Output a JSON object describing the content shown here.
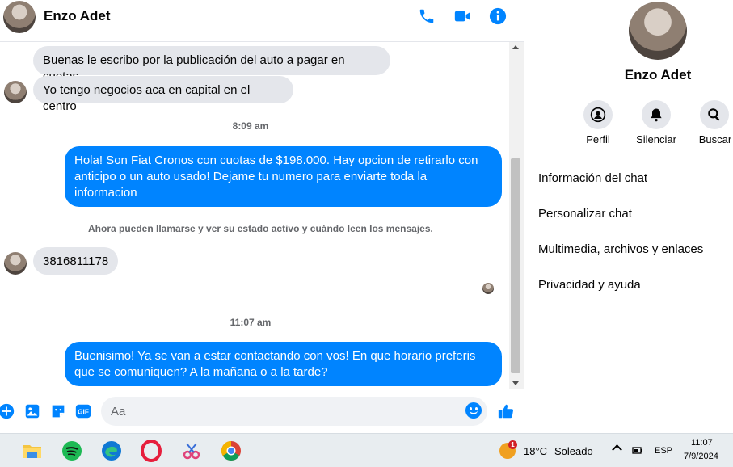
{
  "header": {
    "contact_name": "Enzo Adet",
    "actions": [
      "phone-icon",
      "video-icon",
      "info-icon"
    ],
    "accent": "#0084ff"
  },
  "messages": [
    {
      "side": "in",
      "text": "Buenas le escribo por la publicación del auto a pagar en cuotas"
    },
    {
      "side": "in",
      "text": "Yo tengo negocios aca en capital en el centro"
    },
    {
      "type": "time",
      "text": "8:09 am"
    },
    {
      "side": "out",
      "text": "Hola! Son Fiat Cronos con cuotas de $198.000. Hay opcion de retirarlo con anticipo o un auto usado! Dejame tu numero para enviarte toda la informacion"
    },
    {
      "type": "notice",
      "text": "Ahora pueden llamarse y ver su estado activo y cuándo leen los mensajes."
    },
    {
      "side": "in",
      "text": "3816811178"
    },
    {
      "type": "time",
      "text": "11:07 am"
    },
    {
      "side": "out",
      "text": "Buenisimo! Ya se van a estar contactando con vos! En que horario preferis que se comuniquen? A la mañana o a la tarde?"
    }
  ],
  "composer": {
    "placeholder": "Aa",
    "icons": [
      "plus-icon",
      "image-icon",
      "sticker-icon",
      "gif-icon",
      "emoji-icon",
      "like-icon"
    ]
  },
  "panel": {
    "name": "Enzo Adet",
    "buttons": [
      {
        "icon": "profile-icon",
        "label": "Perfil"
      },
      {
        "icon": "bell-icon",
        "label": "Silenciar"
      },
      {
        "icon": "search-icon",
        "label": "Buscar"
      }
    ],
    "items": [
      "Información del chat",
      "Personalizar chat",
      "Multimedia, archivos y enlaces",
      "Privacidad y ayuda"
    ]
  },
  "taskbar": {
    "apps": [
      "file-explorer-icon",
      "spotify-icon",
      "edge-icon",
      "opera-icon",
      "snipping-tool-icon",
      "chrome-icon"
    ],
    "weather": {
      "temp": "18°C",
      "condition": "Soleado",
      "badge": "1"
    },
    "language": "ESP",
    "time": "11:07",
    "date": "7/9/2024"
  }
}
